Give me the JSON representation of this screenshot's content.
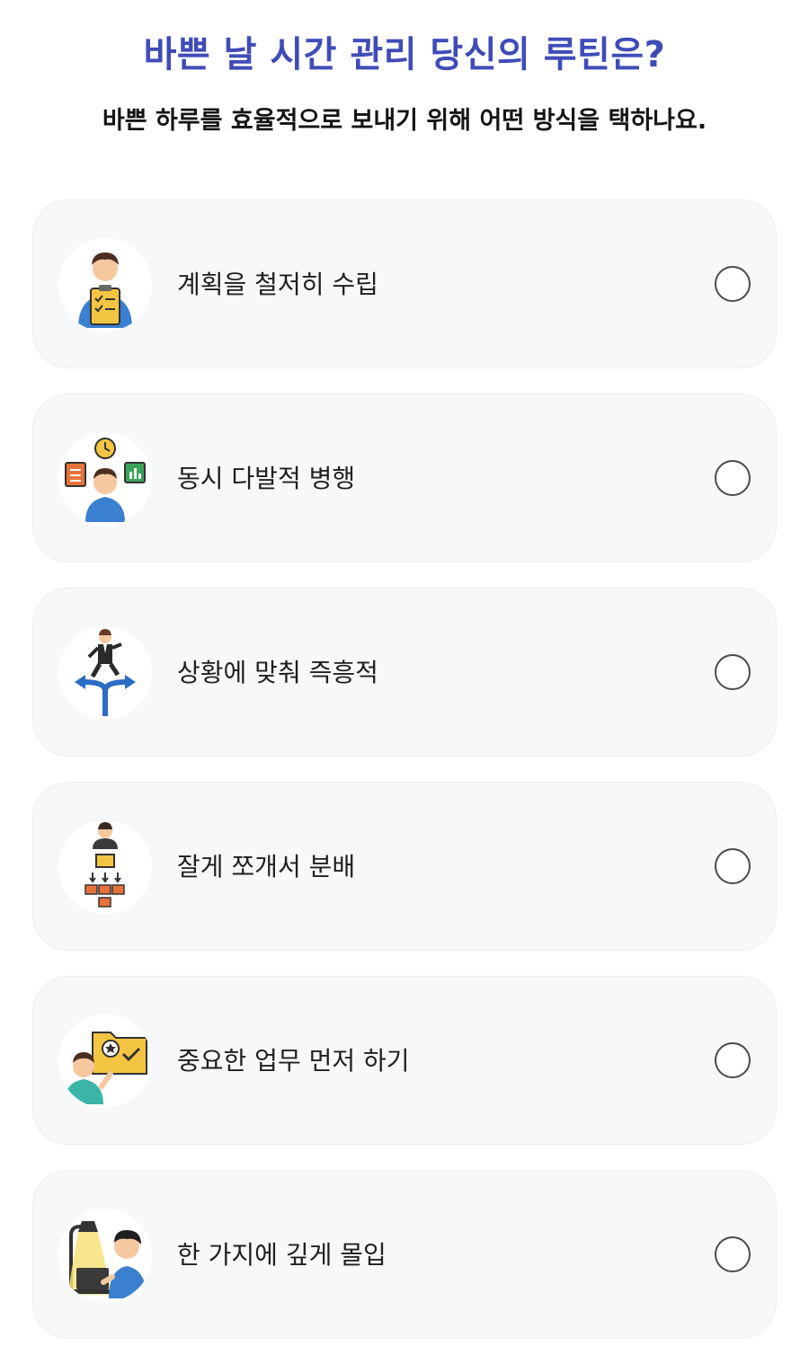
{
  "header": {
    "title": "바쁜 날 시간 관리 당신의 루틴은?",
    "subtitle": "바쁜 하루를 효율적으로 보내기 위해 어떤 방식을 택하나요."
  },
  "options": [
    {
      "label": "계획을 철저히 수립",
      "icon": "planner-clipboard-icon",
      "selected": false
    },
    {
      "label": "동시 다발적 병행",
      "icon": "multitasking-icon",
      "selected": false
    },
    {
      "label": "상황에 맞춰 즉흥적",
      "icon": "crossroads-icon",
      "selected": false
    },
    {
      "label": "잘게 쪼개서 분배",
      "icon": "task-breakdown-icon",
      "selected": false
    },
    {
      "label": "중요한 업무 먼저 하기",
      "icon": "priority-folder-icon",
      "selected": false
    },
    {
      "label": "한 가지에 깊게 몰입",
      "icon": "deep-focus-icon",
      "selected": false
    }
  ],
  "colors": {
    "title": "#3f4cb8",
    "card_background": "#f7f8fa",
    "radio_border": "#4a4a4a"
  }
}
